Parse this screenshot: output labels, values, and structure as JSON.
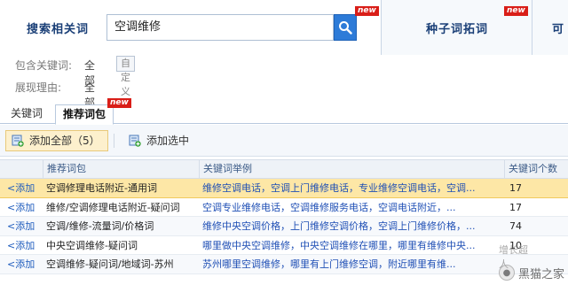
{
  "top_tabs": {
    "search_label": "搜索相关词",
    "search_value": "空调维修",
    "search_new_badge": "new",
    "seed_label": "种子词拓词",
    "seed_new_badge": "new",
    "extra_label": "可"
  },
  "filters": {
    "contains_label": "包含关键词:",
    "contains_value": "全部",
    "custom_label": "自定义",
    "reason_label": "展现理由:",
    "reason_value": "全部"
  },
  "sub_tabs": {
    "keywords": "关键词",
    "recommended": "推荐词包",
    "recommended_new_badge": "new"
  },
  "toolbar": {
    "add_all": "添加全部（5）",
    "add_selected": "添加选中"
  },
  "table": {
    "headers": {
      "package": "推荐词包",
      "examples": "关键词举例",
      "count": "关键词个数"
    },
    "rows": [
      {
        "add": "<添加",
        "package": "空调修理电话附近-通用词",
        "examples": "维修空调电话，空调上门维修电话，专业维修空调电话，空调...",
        "count": "17"
      },
      {
        "add": "<添加",
        "package": "维修/空调修理电话附近-疑问词",
        "examples": "空调专业维修电话，空调维修服务电话，空调电话附近，...",
        "count": "17"
      },
      {
        "add": "<添加",
        "package": "空调/维修-流量词/价格词",
        "examples": "维修中央空调价格，上门维修空调价格，空调上门维修价格，...",
        "count": "74"
      },
      {
        "add": "<添加",
        "package": "中央空调维修-疑问词",
        "examples": "哪里做中央空调维修，中央空调维修在哪里，哪里有维修中央...",
        "count": "10"
      },
      {
        "add": "<添加",
        "package": "空调维修-疑问词/地域词-苏州",
        "examples": "苏州哪里空调维修，哪里有上门维修空调，附近哪里有维...",
        "count": ""
      }
    ]
  },
  "watermark": {
    "text": "黑猫之家",
    "overlay_text": "增长超人"
  }
}
